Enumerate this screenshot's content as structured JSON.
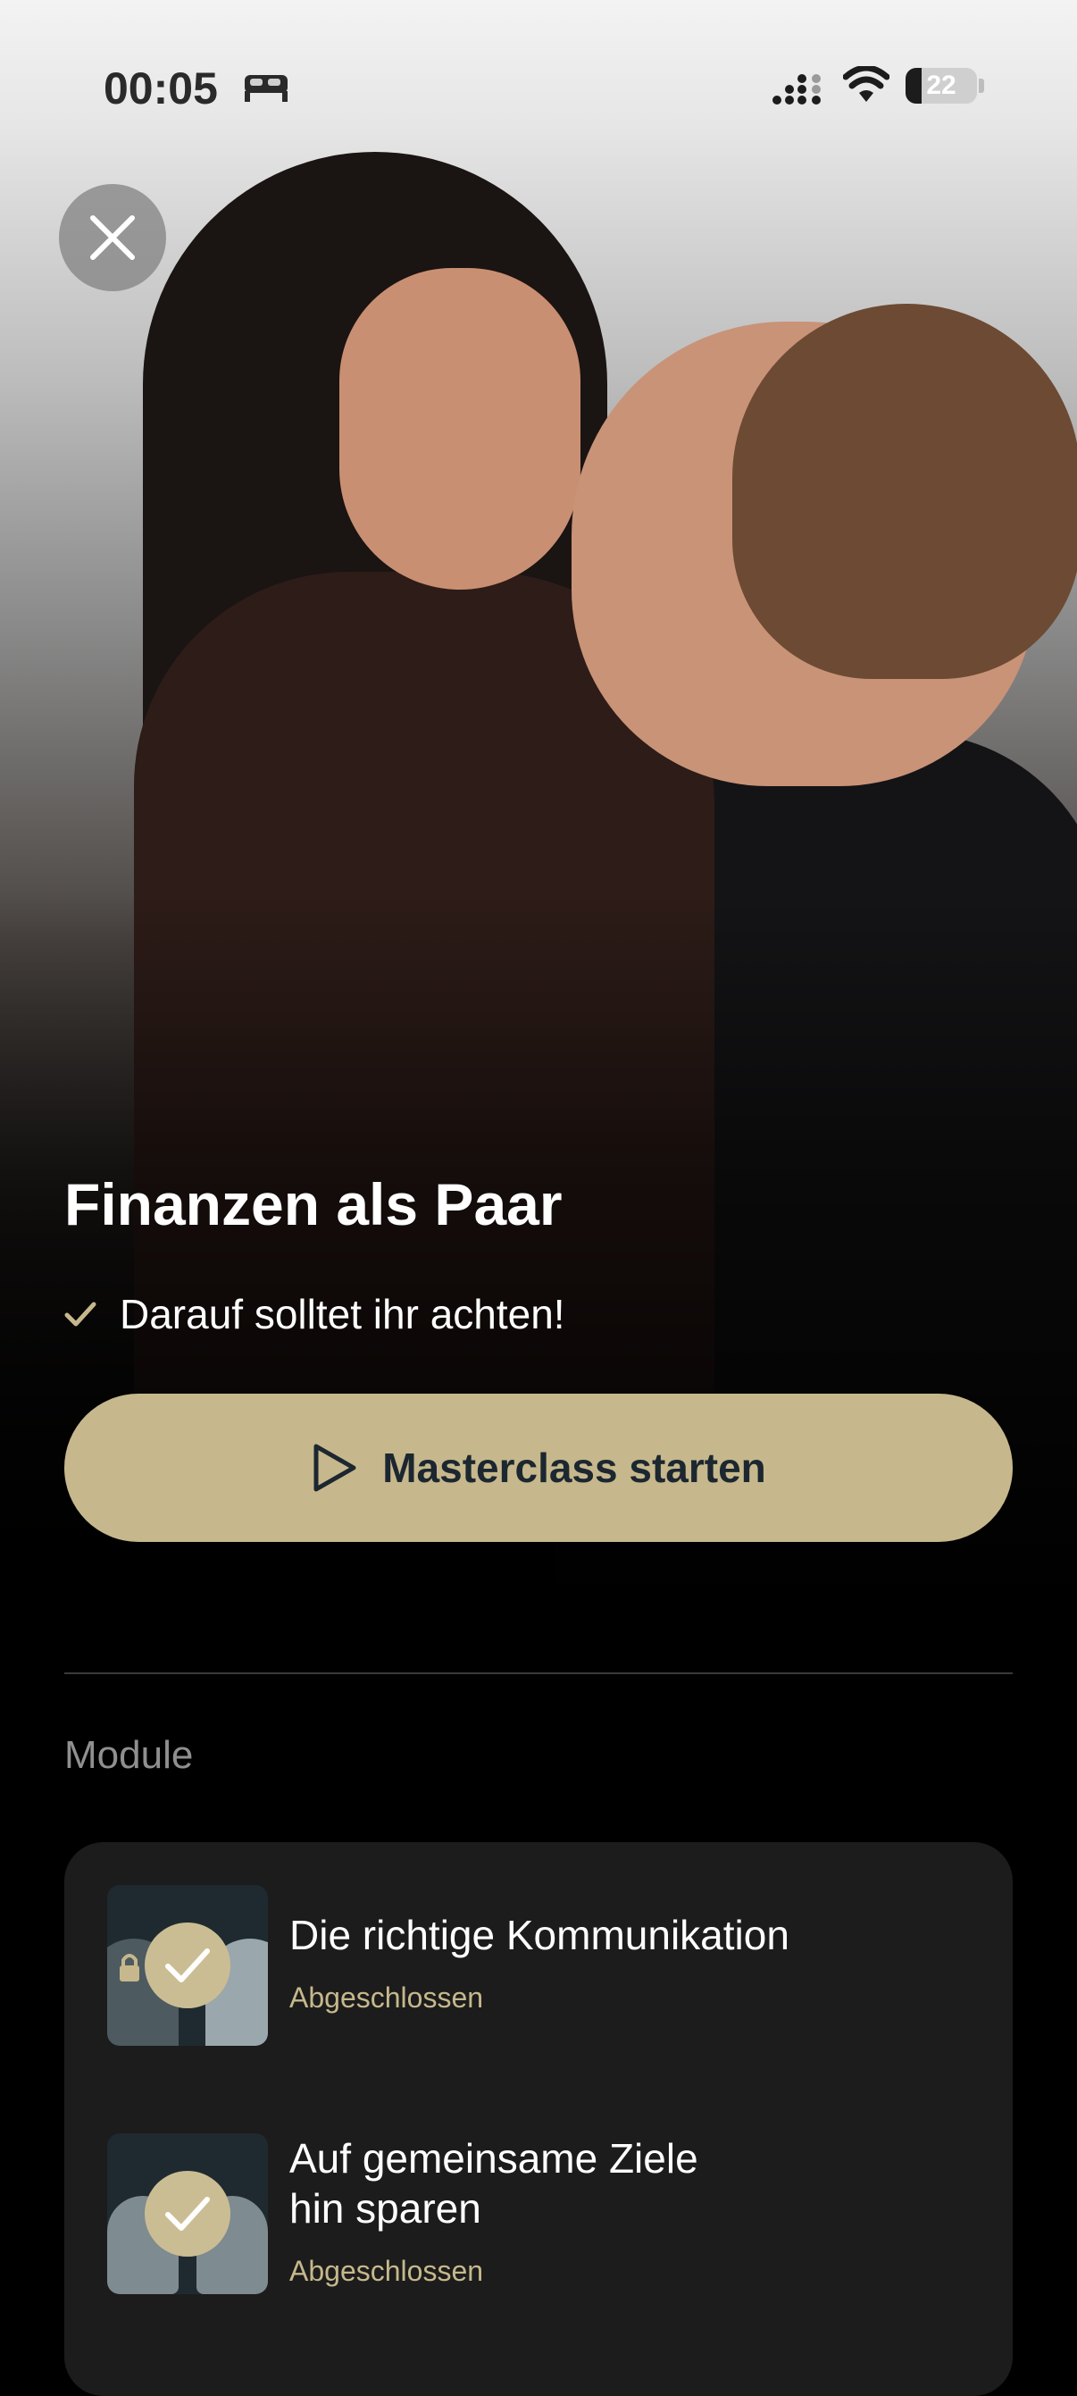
{
  "status_bar": {
    "time": "00:05",
    "battery": "22",
    "battery_level": 0.22,
    "icons": [
      "bed-icon",
      "signal-icon",
      "wifi-icon",
      "battery-icon"
    ]
  },
  "hero": {
    "title": "Finanzen als Paar",
    "subtitle": "Darauf solltet ihr achten!"
  },
  "cta": {
    "label": "Masterclass starten"
  },
  "modules": {
    "section_label": "Module",
    "items": [
      {
        "title": "Die richtige Kommunikation",
        "status": "Abgeschlossen"
      },
      {
        "title_line1": "Auf gemeinsame Ziele",
        "title_line2": "hin sparen",
        "status": "Abgeschlossen"
      }
    ]
  },
  "colors": {
    "accent": "#c6b88c",
    "cta_text": "#1c2730",
    "card": "#1c1c1c",
    "background": "#000000"
  }
}
